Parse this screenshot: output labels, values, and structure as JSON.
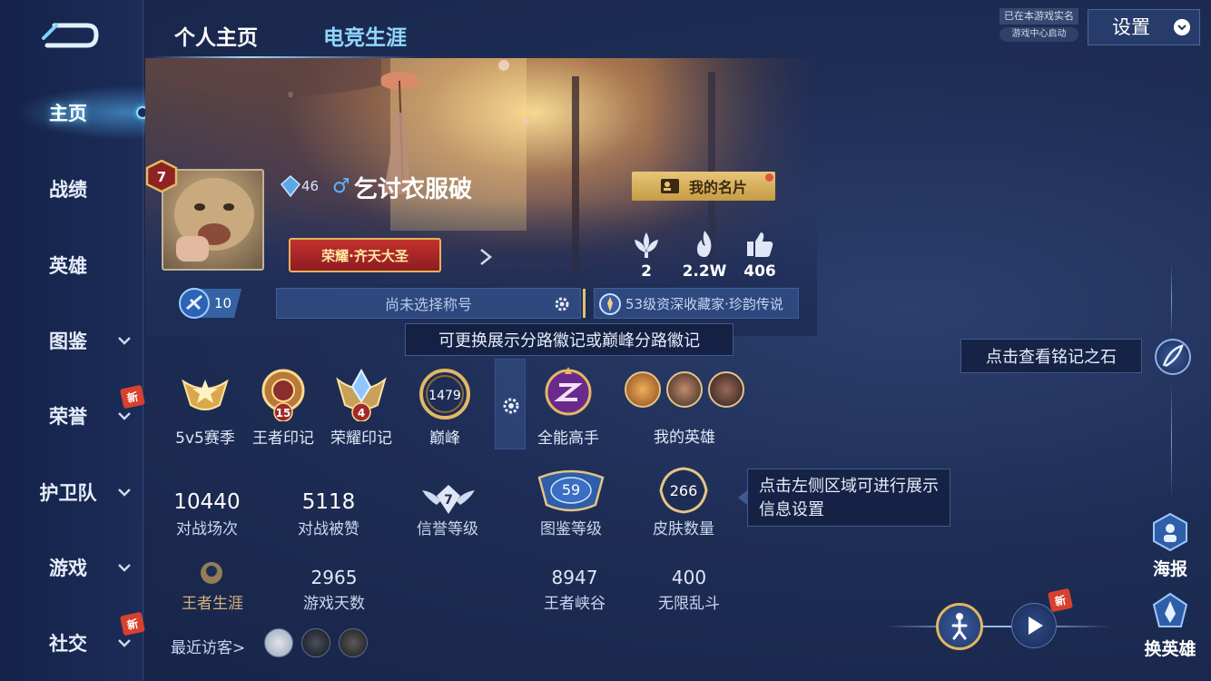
{
  "sidebar": {
    "items": [
      {
        "label": "主页",
        "active": true
      },
      {
        "label": "战绩"
      },
      {
        "label": "英雄"
      },
      {
        "label": "图鉴",
        "has_dropdown": true
      },
      {
        "label": "荣誉",
        "has_dropdown": true,
        "new": true
      },
      {
        "label": "护卫队",
        "has_dropdown": true
      },
      {
        "label": "游戏",
        "has_dropdown": true
      },
      {
        "label": "社交",
        "has_dropdown": true,
        "new": true
      }
    ],
    "new_badge": "新"
  },
  "tabs": [
    {
      "label": "个人主页",
      "active": true
    },
    {
      "label": "电竞生涯",
      "active": false
    }
  ],
  "profile": {
    "level": "7",
    "rank_level": "46",
    "gender_icon": "♂",
    "nickname": "乞讨衣服破",
    "name_card_label": "我的名片",
    "honor_title": "荣耀·齐天大圣",
    "vip_level": "10",
    "title_placeholder": "尚未选择称号",
    "collector_title": "53级资深收藏家·珍韵传说",
    "stats": [
      {
        "icon": "lotus-icon",
        "value": "2"
      },
      {
        "icon": "flame-icon",
        "value": "2.2W"
      },
      {
        "icon": "thumbs-up-icon",
        "value": "406"
      }
    ]
  },
  "tips": {
    "lane_badge": "可更换展示分路徽记或巅峰分路徽记",
    "info_settings": "点击左侧区域可进行展示信息设置",
    "rune": "点击查看铭记之石"
  },
  "badges": [
    {
      "label": "5v5赛季",
      "num": ""
    },
    {
      "label": "王者印记",
      "num": "15"
    },
    {
      "label": "荣耀印记",
      "num": "4"
    },
    {
      "label": "巅峰",
      "num": "1479"
    },
    {
      "label": "全能高手",
      "num": ""
    }
  ],
  "my_heroes_label": "我的英雄",
  "stats_row1": [
    {
      "value": "10440",
      "label": "对战场次"
    },
    {
      "value": "5118",
      "label": "对战被赞"
    },
    {
      "value": "7",
      "label": "信誉等级"
    },
    {
      "value": "59",
      "label": "图鉴等级"
    },
    {
      "value": "266",
      "label": "皮肤数量"
    }
  ],
  "stats_row2": [
    {
      "value": "",
      "label": "王者生涯"
    },
    {
      "value": "2965",
      "label": "游戏天数"
    },
    {
      "value": "8947",
      "label": "王者峡谷"
    },
    {
      "value": "400",
      "label": "无限乱斗"
    }
  ],
  "visitors_label": "最近访客>",
  "top_right": {
    "realname": "已在本游戏实名",
    "game_center": "游戏中心启动",
    "settings": "设置"
  },
  "right_actions": [
    {
      "label": "海报",
      "icon": "poster-icon"
    },
    {
      "label": "换英雄",
      "icon": "switch-hero-icon"
    }
  ],
  "colors": {
    "background": "#1e2d55",
    "accent_gold": "#e6c06b",
    "accent_blue": "#8fd7ff",
    "honor_red": "#c3312d"
  }
}
